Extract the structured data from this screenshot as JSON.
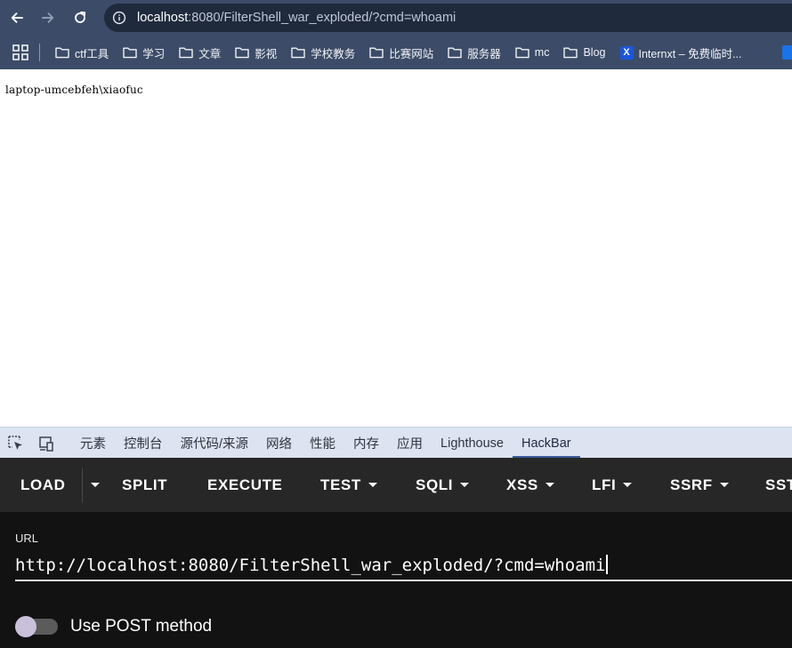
{
  "browser": {
    "address_bar": {
      "host": "localhost",
      "rest": ":8080/FilterShell_war_exploded/?cmd=whoami"
    }
  },
  "bookmarks": [
    {
      "label": "ctf工具",
      "icon": "folder-icon"
    },
    {
      "label": "学习",
      "icon": "folder-icon"
    },
    {
      "label": "文章",
      "icon": "folder-icon"
    },
    {
      "label": "影视",
      "icon": "folder-icon"
    },
    {
      "label": "学校教务",
      "icon": "folder-icon"
    },
    {
      "label": "比赛网站",
      "icon": "folder-icon"
    },
    {
      "label": "服务器",
      "icon": "folder-icon"
    },
    {
      "label": "mc",
      "icon": "folder-icon"
    },
    {
      "label": "Blog",
      "icon": "folder-icon"
    },
    {
      "label": "Internxt – 免费临时...",
      "icon": "internxt-x-icon"
    }
  ],
  "page": {
    "output": "laptop-umcebfeh\\xiaofuc"
  },
  "devtools": {
    "tabs": [
      "元素",
      "控制台",
      "源代码/来源",
      "网络",
      "性能",
      "内存",
      "应用",
      "Lighthouse",
      "HackBar"
    ],
    "active_tab": "HackBar"
  },
  "hackbar": {
    "buttons": [
      "LOAD",
      "SPLIT",
      "EXECUTE",
      "TEST",
      "SQLI",
      "XSS",
      "LFI",
      "SSRF",
      "SST"
    ],
    "url_label": "URL",
    "url_value": "http://localhost:8080/FilterShell_war_exploded/?cmd=whoami",
    "post_toggle_label": "Use POST method",
    "post_enabled": false
  },
  "colors": {
    "browser_chrome": "#3c4c68",
    "devtools_tabbar": "#dee3f1",
    "hackbar_toolbar": "#272727",
    "hackbar_body": "#121212"
  }
}
